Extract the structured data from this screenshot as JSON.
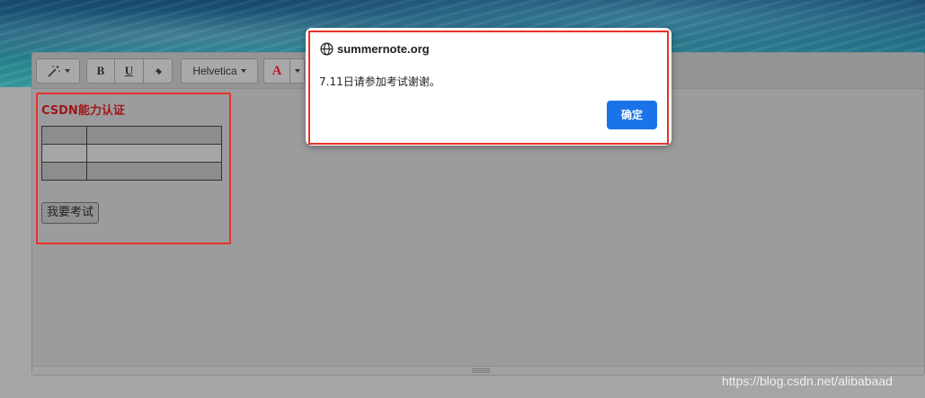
{
  "toolbar": {
    "magic_icon": "magic-wand-icon",
    "bold_label": "B",
    "underline_label": "U",
    "eraser_icon": "eraser-icon",
    "font_name": "Helvetica",
    "color_label": "A"
  },
  "content": {
    "title": "CSDN能力认证",
    "table_rows": [
      [
        "",
        ""
      ],
      [
        "",
        ""
      ],
      [
        "",
        ""
      ]
    ],
    "button_label": "我要考试"
  },
  "dialog": {
    "site_icon": "globe-icon",
    "site": "summernote.org",
    "message": "7.11日请参加考试谢谢。",
    "ok_label": "确定"
  },
  "watermark": "https://blog.csdn.net/alibabaad",
  "colors": {
    "highlight_border": "#e63228",
    "title_color": "#a0161a",
    "ok_button": "#1a73e8",
    "font_color_A": "#c0181f"
  }
}
